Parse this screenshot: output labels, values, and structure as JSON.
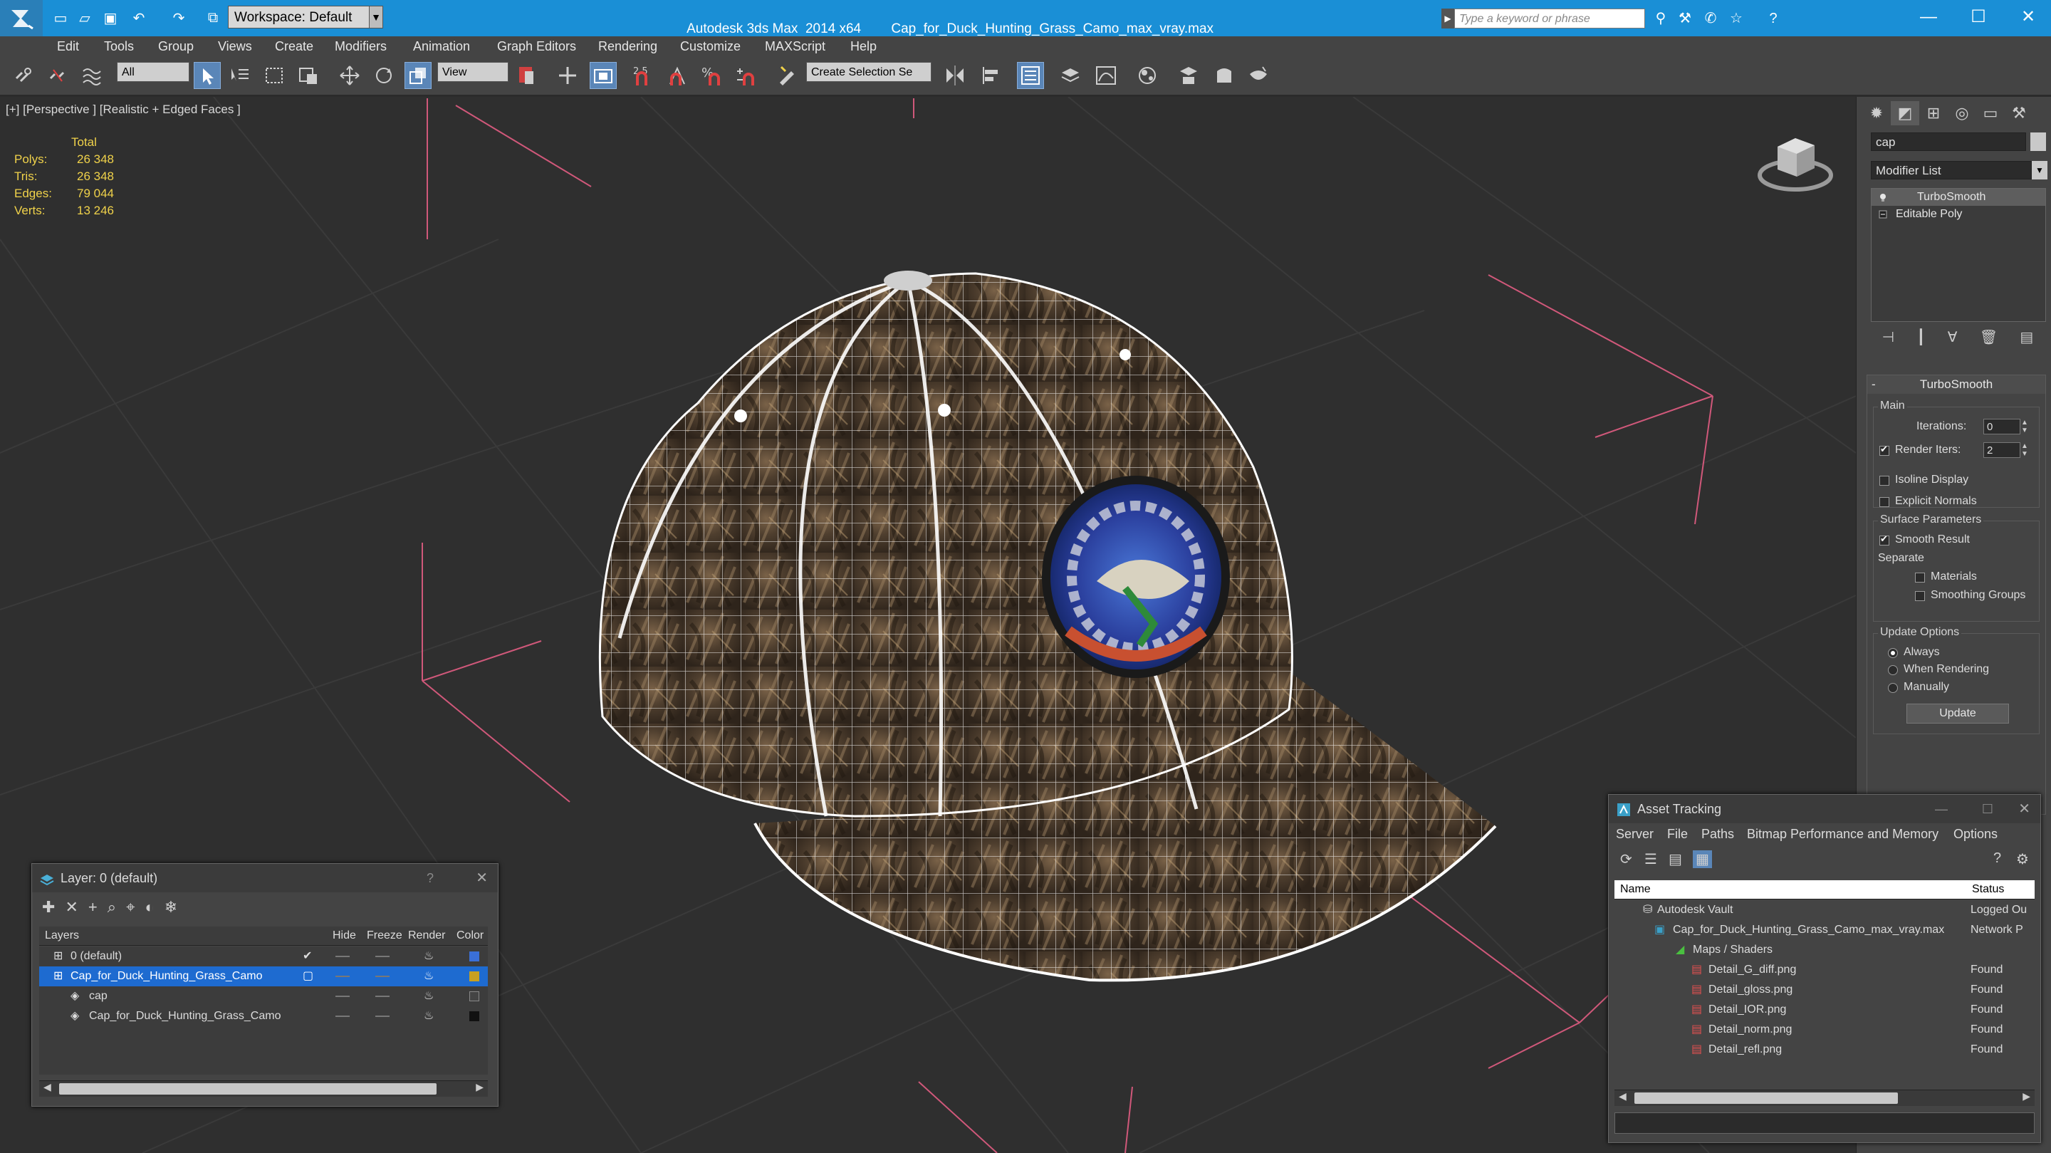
{
  "titlebar": {
    "workspace": "Workspace: Default",
    "app_title": "Autodesk 3ds Max  2014 x64",
    "file_title": "Cap_for_Duck_Hunting_Grass_Camo_max_vray.max",
    "search_placeholder": "Type a keyword or phrase"
  },
  "menu": [
    "Edit",
    "Tools",
    "Group",
    "Views",
    "Create",
    "Modifiers",
    "Animation",
    "Graph Editors",
    "Rendering",
    "Customize",
    "MAXScript",
    "Help"
  ],
  "toolbar": {
    "selection_filter": "All",
    "ref_coord": "View",
    "selection_set": "Create Selection Se",
    "snap_label": "2.5",
    "percent_label": "%"
  },
  "viewport": {
    "label": "[+] [Perspective ] [Realistic + Edged Faces ]",
    "stats_header": "Total",
    "stats": [
      {
        "k": "Polys:",
        "v": "26 348"
      },
      {
        "k": "Tris:",
        "v": "26 348"
      },
      {
        "k": "Edges:",
        "v": "79 044"
      },
      {
        "k": "Verts:",
        "v": "13 246"
      }
    ]
  },
  "command_panel": {
    "object_name": "cap",
    "modifier_list": "Modifier List",
    "stack": [
      "TurboSmooth",
      "Editable Poly"
    ],
    "turbosmooth": {
      "title": "TurboSmooth",
      "main": "Main",
      "iterations_label": "Iterations:",
      "iterations": "0",
      "render_iters_label": "Render Iters:",
      "render_iters": "2",
      "isoline": "Isoline Display",
      "explicit": "Explicit Normals",
      "surface_params": "Surface Parameters",
      "smooth_result": "Smooth Result",
      "separate": "Separate",
      "materials": "Materials",
      "smoothing_groups": "Smoothing Groups",
      "update_options": "Update Options",
      "always": "Always",
      "when_rendering": "When Rendering",
      "manually": "Manually",
      "update_btn": "Update"
    }
  },
  "layer_window": {
    "title": "Layer: 0 (default)",
    "help": "?",
    "columns": [
      "Layers",
      "Hide",
      "Freeze",
      "Render",
      "Color"
    ],
    "rows": [
      {
        "name": "0 (default)",
        "color": "#3a6fd8"
      },
      {
        "name": "Cap_for_Duck_Hunting_Grass_Camo",
        "color": "#c8a020"
      },
      {
        "name": "cap",
        "color": "#444444"
      },
      {
        "name": "Cap_for_Duck_Hunting_Grass_Camo",
        "color": "#111111"
      }
    ]
  },
  "asset_window": {
    "title": "Asset Tracking",
    "menu": [
      "Server",
      "File",
      "Paths",
      "Bitmap Performance and Memory",
      "Options"
    ],
    "columns": [
      "Name",
      "Status"
    ],
    "rows": [
      {
        "name": "Autodesk Vault",
        "status": "Logged Ou"
      },
      {
        "name": "Cap_for_Duck_Hunting_Grass_Camo_max_vray.max",
        "status": "Network P"
      },
      {
        "name": "Maps / Shaders",
        "status": ""
      },
      {
        "name": "Detail_G_diff.png",
        "status": "Found"
      },
      {
        "name": "Detail_gloss.png",
        "status": "Found"
      },
      {
        "name": "Detail_IOR.png",
        "status": "Found"
      },
      {
        "name": "Detail_norm.png",
        "status": "Found"
      },
      {
        "name": "Detail_refl.png",
        "status": "Found"
      }
    ]
  },
  "colors": {
    "titlebar": "#1a8fd6",
    "selection": "#1e6bd0",
    "panel": "#444444",
    "viewport_bg": "#2f2f2f"
  }
}
